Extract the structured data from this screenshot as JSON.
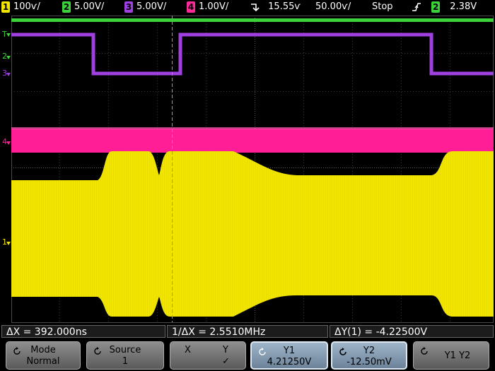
{
  "topbar": {
    "ch1": {
      "num": "1",
      "scale": "100ѵ/",
      "color": "#f2e600"
    },
    "ch2": {
      "num": "2",
      "scale": "5.00V/",
      "color": "#3cd23c"
    },
    "ch3": {
      "num": "3",
      "scale": "5.00V/",
      "color": "#a040e0"
    },
    "ch4": {
      "num": "4",
      "scale": "1.00V/",
      "color": "#ff2a9a"
    },
    "delay": "15.55ѵ",
    "timebase": "50.00ѵ/",
    "run_state": "Stop",
    "trigger_source": "2",
    "trigger_level": "2.38V"
  },
  "markers": {
    "m1": "1",
    "m2": "2",
    "m3": "3",
    "m4": "4",
    "mT": "T"
  },
  "measurements": {
    "delta_x": "ΔX = 392.000ns",
    "inv_delta_x": "1/ΔX = 2.5510MHz",
    "delta_y": "ΔY(1) = -4.22500V"
  },
  "softkeys": {
    "mode": {
      "title": "Mode",
      "value": "Normal"
    },
    "source": {
      "title": "Source",
      "value": "1"
    },
    "xy": {
      "left": "X",
      "right": "Y",
      "check": "✓"
    },
    "y1": {
      "title": "Y1",
      "value": "4.21250V"
    },
    "y2": {
      "title": "Y2",
      "value": "-12.50mV"
    },
    "y1y2": {
      "title": "Y1 Y2"
    }
  },
  "colors": {
    "ch1": "#f2e600",
    "ch2": "#3cd23c",
    "ch3": "#a040e0",
    "ch4": "#ff1e96",
    "cursor": "#ff7a1a"
  }
}
